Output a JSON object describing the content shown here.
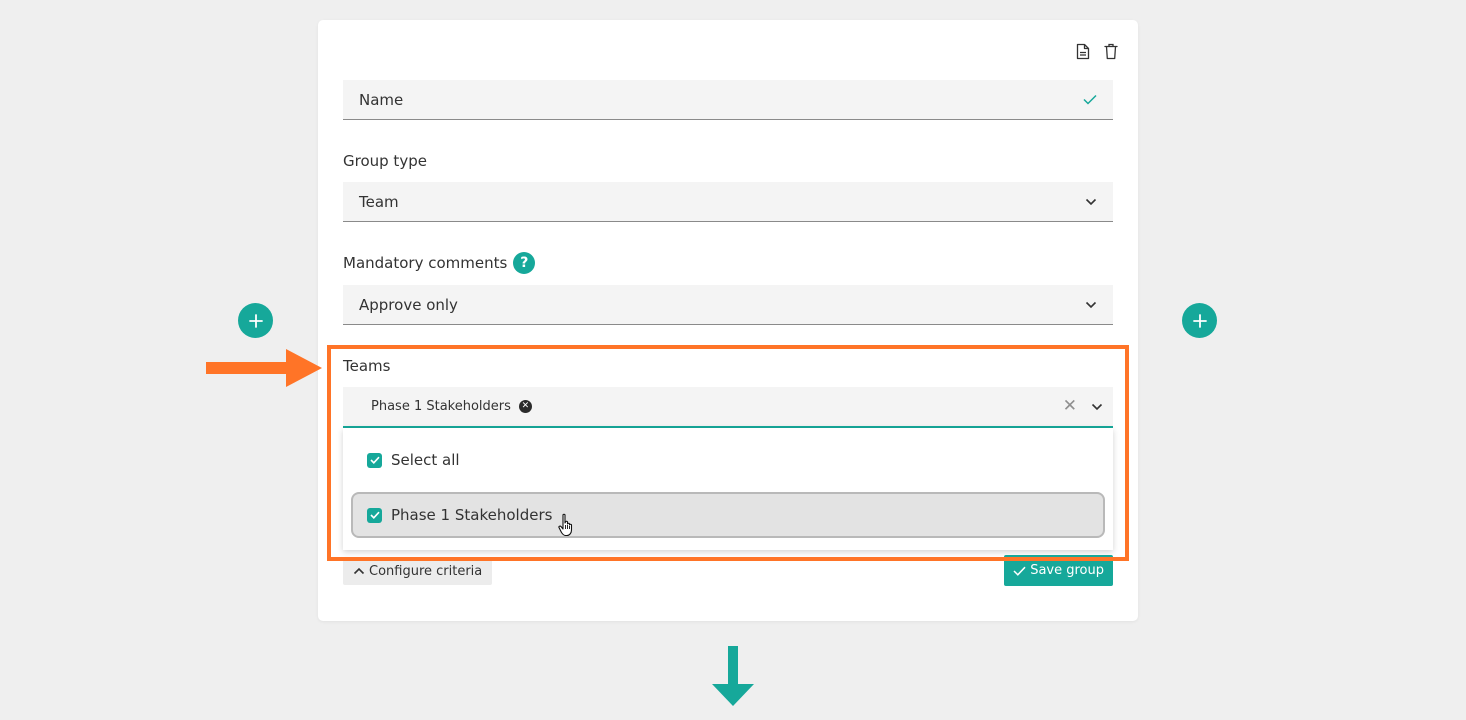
{
  "form": {
    "name_placeholder": "Name",
    "group_type_label": "Group type",
    "group_type_value": "Team",
    "mandatory_comments_label": "Mandatory comments",
    "mandatory_comments_help": "?",
    "mandatory_comments_value": "Approve only",
    "teams_label": "Teams",
    "teams_selected_chip": "Phase 1 Stakeholders",
    "teams_options": [
      {
        "label": "Select all",
        "checked": true
      },
      {
        "label": "Phase 1 Stakeholders",
        "checked": true,
        "highlighted": true
      }
    ],
    "configure_criteria_label": "Configure criteria",
    "save_group_label": "Save group"
  },
  "icons": {
    "document": "document-icon",
    "trash": "trash-icon",
    "valid_check": "check-icon",
    "chevron": "chevron-down-icon",
    "chip_remove": "x-circle-icon",
    "clear": "x-icon",
    "add": "plus-icon",
    "chevron_up": "chevron-up-icon",
    "save_check": "check-icon",
    "cursor": "hand-pointer-icon"
  },
  "colors": {
    "accent": "#16a89a",
    "annotation": "#ff7427",
    "background": "#efefef",
    "card": "#ffffff"
  }
}
